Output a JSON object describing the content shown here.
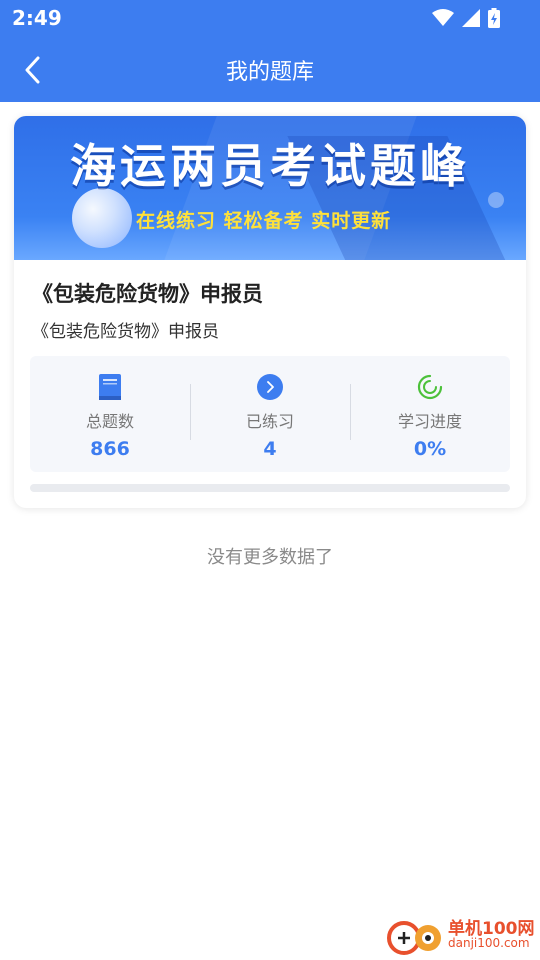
{
  "status_bar": {
    "time": "2:49",
    "icons": [
      "wifi-icon",
      "signal-icon",
      "battery-charging-icon"
    ]
  },
  "header": {
    "title": "我的题库",
    "back_icon": "back-arrow-icon"
  },
  "course": {
    "banner_title": "海运两员考试题峰",
    "banner_subtitle": "在线练习 轻松备考 实时更新",
    "title": "《包装危险货物》申报员",
    "subtitle": "《包装危险货物》申报员",
    "stats": [
      {
        "icon": "book-icon",
        "label": "总题数",
        "value": "866"
      },
      {
        "icon": "arrow-circle-icon",
        "label": "已练习",
        "value": "4"
      },
      {
        "icon": "progress-ring-icon",
        "label": "学习进度",
        "value": "0%"
      }
    ],
    "progress_fraction": 0
  },
  "footer_text": "没有更多数据了",
  "watermark": {
    "name": "单机100网",
    "url": "danji100.com"
  },
  "colors": {
    "primary": "#3d7df0",
    "banner_subtitle": "#ffe13a",
    "watermark": "#e8502d",
    "progress_green": "#4cc13a"
  }
}
